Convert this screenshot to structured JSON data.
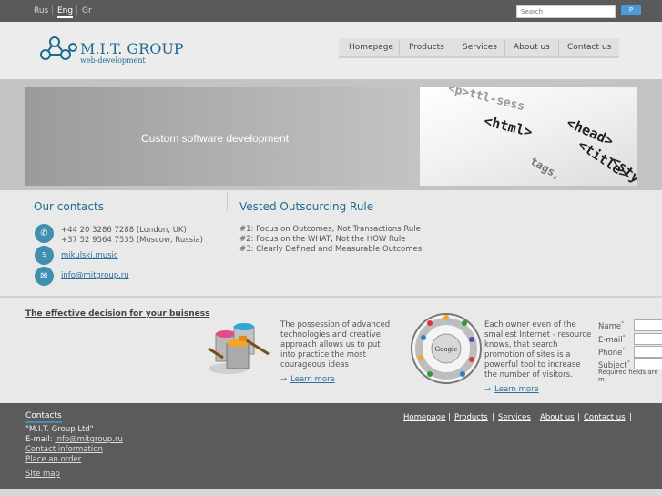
{
  "top_bar": {
    "languages": [
      {
        "label": "Rus"
      },
      {
        "label": "Eng",
        "selected": true
      },
      {
        "label": "Gr"
      }
    ],
    "search": {
      "placeholder": "Search",
      "button_label": "P"
    }
  },
  "header": {
    "logo_title": "M.I.T. GROUP",
    "logo_subtitle": "web-development",
    "nav": [
      "Homepage",
      "Products",
      "Services",
      "About us",
      "Contact us"
    ]
  },
  "banner": {
    "text": "Custom software development",
    "code_lines": [
      "<html>",
      "<head>",
      "<title>",
      "<style>",
      "tags,"
    ]
  },
  "contacts": {
    "heading": "Our contacts",
    "phones": [
      "+44 20 3286 7288 (London, UK)",
      "+37 52 9564 7535 (Moscow, Russia)"
    ],
    "skype": "mikulski.music",
    "email": "info@mitgroup.ru"
  },
  "vested": {
    "heading": "Vested Outsourcing Rule",
    "rules": [
      "#1: Focus on Outcomes, Not Transactions Rule",
      "#2: Focus on the WHAT, Not the HOW Rule",
      "#3: Clearly Defined and Measurable Outcomes"
    ]
  },
  "decision": {
    "title": "The effective decision for your buisness",
    "block1": {
      "lines": [
        "The possession of advanced",
        "technologies and creative",
        "approach allows us to put",
        "into practice the most",
        "courageous ideas"
      ],
      "link": "Learn more"
    },
    "block2": {
      "lines": [
        "Each owner even of the",
        "smallest Internet - resource",
        "knows, that search",
        "promotion of sites is a",
        "powerful tool to increase",
        "the number of visitors."
      ],
      "link": "Learn more",
      "wheel_center": "Google"
    }
  },
  "form": {
    "fields": [
      "Name",
      "E-mail",
      "Phone",
      "Subject"
    ],
    "required_note": "Required fields are m"
  },
  "footer": {
    "heading": "Contacts",
    "company": "\"M.I.T. Group Ltd\"",
    "email_label": "E-mail:",
    "email": "info@mitgroup.ru",
    "links": [
      "Contact information",
      "Place an order",
      "Site map"
    ],
    "nav": [
      "Homepage",
      "Products",
      "Services",
      "About us",
      "Contact us"
    ]
  },
  "colors": {
    "accent": "#1e6b8f",
    "link": "#2d6f9a",
    "footer_bg": "#5b5b5b",
    "topbar_bg": "#5a5a5a"
  }
}
